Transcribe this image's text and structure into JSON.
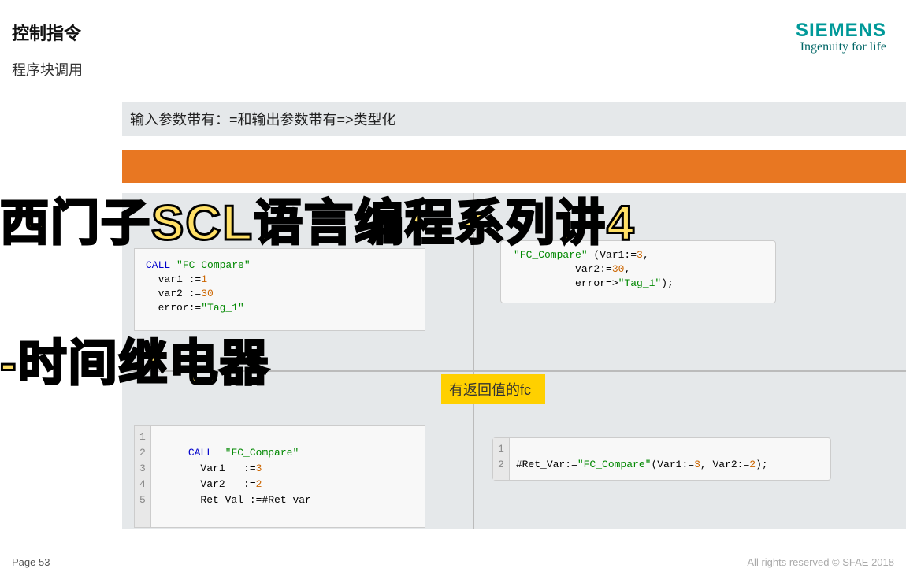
{
  "header": {
    "title": "控制指令",
    "subtitle": "程序块调用"
  },
  "logo": {
    "brand": "SIEMENS",
    "tagline": "Ingenuity for life"
  },
  "info_bar": "输入参数带有：=和输出参数带有=>类型化",
  "overlays": {
    "line1": "西门子SCL语言编程系列讲4",
    "line2": "-时间继电器"
  },
  "yellow_label": "有返回值的fc",
  "code": {
    "box1": {
      "l1_kw": "CALL",
      "l1_str": " \"FC_Compare\"",
      "l2": "  var1 :=",
      "l2_num": "1",
      "l3": "  var2 :=",
      "l3_num": "30",
      "l4": "  error:=",
      "l4_str": "\"Tag_1\""
    },
    "box2": {
      "l1a": "\"FC_Compare\"",
      "l1b": " (Var1:=",
      "l1c": "3",
      "l1d": ",",
      "l2a": "          var2:=",
      "l2b": "30",
      "l2c": ",",
      "l3a": "          error=>",
      "l3b": "\"Tag_1\"",
      "l3c": ");"
    },
    "box3": {
      "nums": [
        "1",
        "2",
        "3",
        "4",
        "5"
      ],
      "l2_kw": "CALL",
      "l2_str": "  \"FC_Compare\"",
      "l3": "  Var1   :=",
      "l3_num": "3",
      "l4": "  Var2   :=",
      "l4_num": "2",
      "l5": "  Ret_Val :=#Ret_var"
    },
    "box4": {
      "nums": [
        "1",
        "2"
      ],
      "l2a": "#Ret_Var:=",
      "l2b": "\"FC_Compare\"",
      "l2c": "(Var1:=",
      "l2d": "3",
      "l2e": ", Var2:=",
      "l2f": "2",
      "l2g": ");"
    }
  },
  "footer": {
    "page": "Page 53",
    "rights": "All rights reserved © SFAE 2018"
  }
}
